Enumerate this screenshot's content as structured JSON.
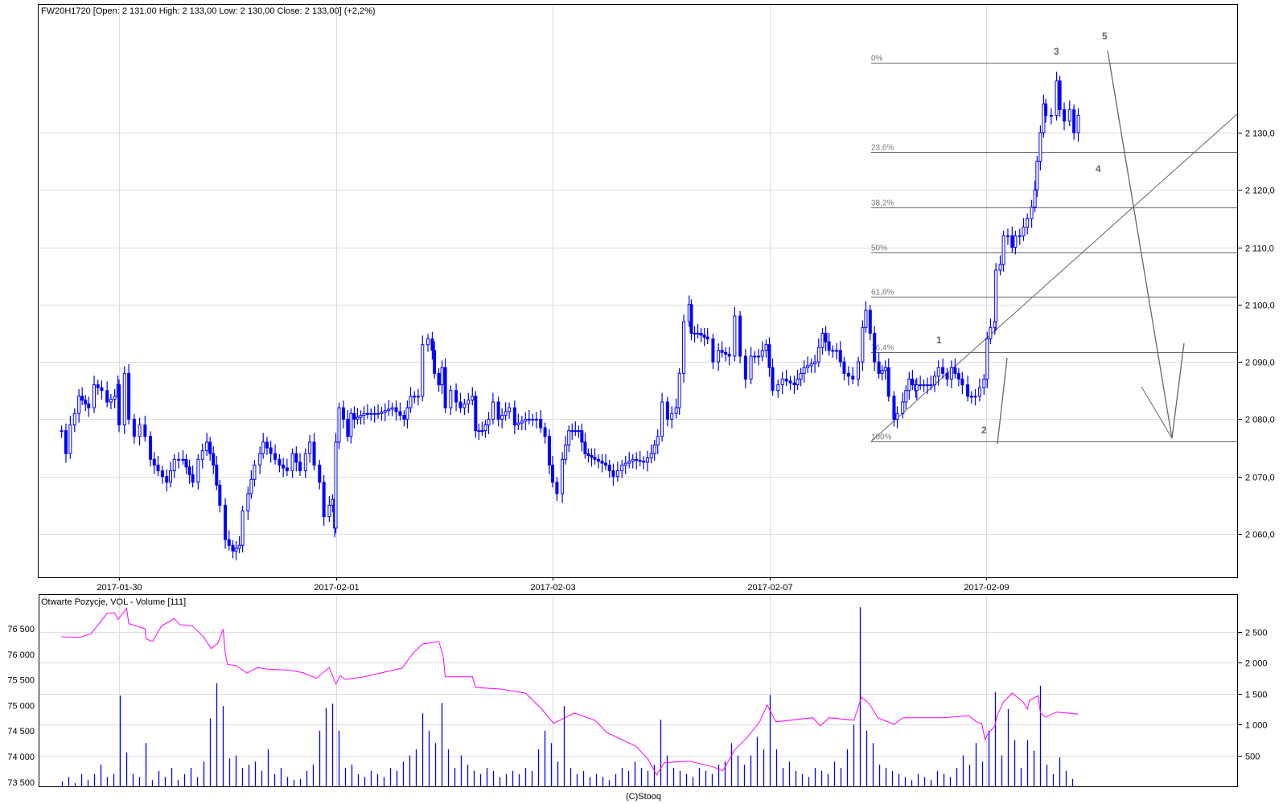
{
  "chart_data": [
    {
      "type": "candlestick",
      "title": "FW20H1720 [Open: 2 131,00  High: 2 133,00  Low: 2 130,00  Close: 2 133,00] (+2,2%)",
      "ylabel": "",
      "ylim": [
        2053,
        2150
      ],
      "x_unit": "trading sessions from 2017-01-30",
      "grid": true,
      "x_ticks": [
        {
          "t": 0,
          "label": "2017-01-30"
        },
        {
          "t": 2,
          "label": "2017-02-01"
        },
        {
          "t": 4,
          "label": "2017-02-03"
        },
        {
          "t": 6,
          "label": "2017-02-07"
        },
        {
          "t": 8,
          "label": "2017-02-09"
        }
      ],
      "y_ticks": [
        {
          "v": 2130,
          "label": "2 130,0"
        },
        {
          "v": 2120,
          "label": "2 120,0"
        },
        {
          "v": 2110,
          "label": "2 110,0"
        },
        {
          "v": 2100,
          "label": "2 100,0"
        },
        {
          "v": 2090,
          "label": "2 090,0"
        },
        {
          "v": 2080,
          "label": "2 080,0"
        },
        {
          "v": 2070,
          "label": "2 070,0"
        },
        {
          "v": 2060,
          "label": "2 060,0"
        }
      ],
      "series_color": "#0000ff",
      "close_points": [
        [
          -0.53,
          2078
        ],
        [
          -0.49,
          2074
        ],
        [
          -0.45,
          2079
        ],
        [
          -0.41,
          2081
        ],
        [
          -0.37,
          2084
        ],
        [
          -0.28,
          2082
        ],
        [
          -0.23,
          2086
        ],
        [
          -0.16,
          2085
        ],
        [
          -0.11,
          2083
        ],
        [
          -0.04,
          2084
        ],
        [
          -0.01,
          2086
        ],
        [
          0.0,
          2079
        ],
        [
          0.05,
          2088
        ],
        [
          0.09,
          2080
        ],
        [
          0.14,
          2077
        ],
        [
          0.19,
          2079
        ],
        [
          0.24,
          2077
        ],
        [
          0.29,
          2073
        ],
        [
          0.36,
          2071
        ],
        [
          0.44,
          2069
        ],
        [
          0.51,
          2073
        ],
        [
          0.59,
          2073
        ],
        [
          0.68,
          2069
        ],
        [
          0.73,
          2073
        ],
        [
          0.81,
          2076
        ],
        [
          0.87,
          2072
        ],
        [
          0.93,
          2065
        ],
        [
          0.98,
          2059
        ],
        [
          1.05,
          2057
        ],
        [
          1.11,
          2058
        ],
        [
          1.14,
          2064
        ],
        [
          1.19,
          2067
        ],
        [
          1.25,
          2072
        ],
        [
          1.3,
          2074
        ],
        [
          1.33,
          2076
        ],
        [
          1.4,
          2074
        ],
        [
          1.48,
          2072
        ],
        [
          1.55,
          2071
        ],
        [
          1.6,
          2074
        ],
        [
          1.67,
          2071
        ],
        [
          1.72,
          2074
        ],
        [
          1.76,
          2076
        ],
        [
          1.8,
          2072
        ],
        [
          1.85,
          2069
        ],
        [
          1.89,
          2063
        ],
        [
          1.94,
          2065
        ],
        [
          1.97,
          2066
        ],
        [
          1.99,
          2061
        ],
        [
          2.0,
          2076
        ],
        [
          2.03,
          2082
        ],
        [
          2.07,
          2080
        ],
        [
          2.11,
          2077
        ],
        [
          2.14,
          2081
        ],
        [
          2.17,
          2080
        ],
        [
          2.26,
          2081
        ],
        [
          2.39,
          2081
        ],
        [
          2.52,
          2082
        ],
        [
          2.63,
          2080
        ],
        [
          2.69,
          2084
        ],
        [
          2.76,
          2084
        ],
        [
          2.8,
          2093
        ],
        [
          2.85,
          2094
        ],
        [
          2.89,
          2092
        ],
        [
          2.91,
          2088
        ],
        [
          2.95,
          2086
        ],
        [
          2.98,
          2089
        ],
        [
          3.01,
          2082
        ],
        [
          3.06,
          2085
        ],
        [
          3.11,
          2083
        ],
        [
          3.15,
          2082
        ],
        [
          3.26,
          2084
        ],
        [
          3.29,
          2078
        ],
        [
          3.35,
          2078
        ],
        [
          3.41,
          2080
        ],
        [
          3.45,
          2083
        ],
        [
          3.5,
          2080
        ],
        [
          3.6,
          2082
        ],
        [
          3.65,
          2079
        ],
        [
          3.75,
          2080
        ],
        [
          3.85,
          2080
        ],
        [
          3.93,
          2077
        ],
        [
          3.97,
          2072
        ],
        [
          4.0,
          2069
        ],
        [
          4.04,
          2067
        ],
        [
          4.09,
          2073
        ],
        [
          4.15,
          2078
        ],
        [
          4.24,
          2078
        ],
        [
          4.3,
          2074
        ],
        [
          4.39,
          2073
        ],
        [
          4.49,
          2072
        ],
        [
          4.56,
          2070
        ],
        [
          4.64,
          2072
        ],
        [
          4.74,
          2073
        ],
        [
          4.84,
          2072.5
        ],
        [
          4.91,
          2074
        ],
        [
          4.97,
          2077
        ],
        [
          5.01,
          2083
        ],
        [
          5.06,
          2080
        ],
        [
          5.14,
          2082
        ],
        [
          5.17,
          2088
        ],
        [
          5.21,
          2097
        ],
        [
          5.26,
          2100
        ],
        [
          5.28,
          2095
        ],
        [
          5.34,
          2095
        ],
        [
          5.43,
          2094
        ],
        [
          5.48,
          2090
        ],
        [
          5.53,
          2092
        ],
        [
          5.63,
          2091
        ],
        [
          5.68,
          2098
        ],
        [
          5.73,
          2091
        ],
        [
          5.78,
          2087
        ],
        [
          5.83,
          2091
        ],
        [
          5.9,
          2091
        ],
        [
          5.97,
          2093
        ],
        [
          6.03,
          2085
        ],
        [
          6.08,
          2086
        ],
        [
          6.12,
          2087
        ],
        [
          6.23,
          2086
        ],
        [
          6.32,
          2089
        ],
        [
          6.42,
          2090
        ],
        [
          6.49,
          2095
        ],
        [
          6.55,
          2092
        ],
        [
          6.62,
          2092
        ],
        [
          6.69,
          2088
        ],
        [
          6.77,
          2087
        ],
        [
          6.82,
          2090
        ],
        [
          6.86,
          2096
        ],
        [
          6.89,
          2099
        ],
        [
          6.93,
          2095
        ],
        [
          6.97,
          2090
        ],
        [
          7.01,
          2088
        ],
        [
          7.07,
          2089
        ],
        [
          7.1,
          2084
        ],
        [
          7.15,
          2080
        ],
        [
          7.18,
          2081
        ],
        [
          7.23,
          2083
        ],
        [
          7.29,
          2087
        ],
        [
          7.35,
          2085
        ],
        [
          7.36,
          2086
        ],
        [
          7.49,
          2086
        ],
        [
          7.56,
          2089
        ],
        [
          7.64,
          2087
        ],
        [
          7.68,
          2089
        ],
        [
          7.78,
          2086
        ],
        [
          7.83,
          2084
        ],
        [
          7.9,
          2084
        ],
        [
          7.98,
          2087
        ],
        [
          8.01,
          2094
        ],
        [
          8.04,
          2096
        ],
        [
          8.08,
          2097
        ],
        [
          8.09,
          2106
        ],
        [
          8.13,
          2107
        ],
        [
          8.16,
          2112
        ],
        [
          8.2,
          2112
        ],
        [
          8.24,
          2110
        ],
        [
          8.27,
          2112
        ],
        [
          8.31,
          2112
        ],
        [
          8.38,
          2115
        ],
        [
          8.42,
          2117
        ],
        [
          8.45,
          2120
        ],
        [
          8.47,
          2125
        ],
        [
          8.5,
          2130
        ],
        [
          8.53,
          2135
        ],
        [
          8.55,
          2133
        ],
        [
          8.6,
          2133
        ],
        [
          8.65,
          2139
        ],
        [
          8.68,
          2134
        ],
        [
          8.72,
          2132
        ],
        [
          8.77,
          2134
        ],
        [
          8.81,
          2130
        ],
        [
          8.85,
          2133
        ]
      ],
      "fibonacci": {
        "high": 2142.2,
        "low": 2076.1,
        "levels": [
          {
            "ratio": 0,
            "label": "0%"
          },
          {
            "ratio": 0.236,
            "label": "23,6%"
          },
          {
            "ratio": 0.382,
            "label": "38,2%"
          },
          {
            "ratio": 0.5,
            "label": "50%"
          },
          {
            "ratio": 0.618,
            "label": "61,8%"
          },
          {
            "ratio": 0.764,
            "label": "76,4%"
          },
          {
            "ratio": 1,
            "label": "100%"
          }
        ]
      },
      "wave_labels": [
        "1",
        "2",
        "3",
        "4",
        "5"
      ]
    },
    {
      "type": "bar+line",
      "title": "Otwarte Pozycje, VOL - Volume [111]",
      "left_axis": {
        "name": "Otwarte Pozycje",
        "ylim": [
          73500,
          77000
        ],
        "ticks": [
          "76 500",
          "76 000",
          "75 500",
          "75 000",
          "74 500",
          "74 000",
          "73 500"
        ],
        "tick_values": [
          76500,
          76000,
          75500,
          75000,
          74500,
          74000,
          73500
        ]
      },
      "right_axis": {
        "name": "Volume",
        "ylim": [
          0,
          3000
        ],
        "ticks": [
          "2 500",
          "2 000",
          "1 500",
          "1 000",
          "500"
        ],
        "tick_values": [
          2500,
          2000,
          1500,
          1000,
          500
        ]
      },
      "open_interest_color": "#ff00ff",
      "volume_color": "#0000ff",
      "open_interest": [
        [
          -0.53,
          76343
        ],
        [
          -0.36,
          76330
        ],
        [
          -0.26,
          76400
        ],
        [
          -0.11,
          76800
        ],
        [
          -0.04,
          76810
        ],
        [
          -0.01,
          76680
        ],
        [
          0.07,
          76900
        ],
        [
          0.09,
          76600
        ],
        [
          0.24,
          76500
        ],
        [
          0.25,
          76300
        ],
        [
          0.31,
          76250
        ],
        [
          0.39,
          76550
        ],
        [
          0.51,
          76700
        ],
        [
          0.56,
          76580
        ],
        [
          0.68,
          76550
        ],
        [
          0.78,
          76340
        ],
        [
          0.85,
          76110
        ],
        [
          0.91,
          76210
        ],
        [
          0.96,
          76490
        ],
        [
          0.98,
          76010
        ],
        [
          1.0,
          75800
        ],
        [
          1.08,
          75780
        ],
        [
          1.18,
          75630
        ],
        [
          1.22,
          75680
        ],
        [
          1.28,
          75740
        ],
        [
          1.37,
          75710
        ],
        [
          1.57,
          75690
        ],
        [
          1.7,
          75640
        ],
        [
          1.82,
          75530
        ],
        [
          1.94,
          75740
        ],
        [
          2.0,
          75420
        ],
        [
          2.04,
          75580
        ],
        [
          2.09,
          75510
        ],
        [
          2.24,
          75550
        ],
        [
          2.49,
          75670
        ],
        [
          2.61,
          75730
        ],
        [
          2.72,
          76040
        ],
        [
          2.8,
          76200
        ],
        [
          2.95,
          76250
        ],
        [
          2.99,
          75970
        ],
        [
          3.01,
          75560
        ],
        [
          3.26,
          75560
        ],
        [
          3.29,
          75350
        ],
        [
          3.52,
          75320
        ],
        [
          3.75,
          75240
        ],
        [
          3.9,
          74930
        ],
        [
          4.01,
          74650
        ],
        [
          4.2,
          74850
        ],
        [
          4.39,
          74710
        ],
        [
          4.5,
          74470
        ],
        [
          4.77,
          74200
        ],
        [
          4.88,
          73950
        ],
        [
          4.96,
          73640
        ],
        [
          5.03,
          73880
        ],
        [
          5.26,
          73910
        ],
        [
          5.48,
          73800
        ],
        [
          5.57,
          73720
        ],
        [
          5.68,
          74130
        ],
        [
          5.79,
          74360
        ],
        [
          5.91,
          74680
        ],
        [
          5.98,
          75010
        ],
        [
          6.06,
          74680
        ],
        [
          6.4,
          74760
        ],
        [
          6.47,
          74600
        ],
        [
          6.55,
          74760
        ],
        [
          6.78,
          74710
        ],
        [
          6.85,
          75160
        ],
        [
          6.92,
          75040
        ],
        [
          7.0,
          74760
        ],
        [
          7.15,
          74630
        ],
        [
          7.23,
          74760
        ],
        [
          7.61,
          74760
        ],
        [
          7.84,
          74800
        ],
        [
          7.91,
          74680
        ],
        [
          7.96,
          74640
        ],
        [
          7.99,
          74330
        ],
        [
          8.01,
          74420
        ],
        [
          8.08,
          74600
        ],
        [
          8.1,
          74800
        ],
        [
          8.16,
          75070
        ],
        [
          8.24,
          75240
        ],
        [
          8.3,
          75140
        ],
        [
          8.34,
          75070
        ],
        [
          8.38,
          74930
        ],
        [
          8.4,
          75100
        ],
        [
          8.48,
          75190
        ],
        [
          8.5,
          74850
        ],
        [
          8.55,
          74770
        ],
        [
          8.6,
          74820
        ],
        [
          8.65,
          74870
        ],
        [
          8.75,
          74850
        ],
        [
          8.85,
          74830
        ]
      ],
      "volume_t_start": -0.53,
      "volume_t_step": 0.0594,
      "volume": [
        80,
        150,
        50,
        200,
        100,
        200,
        350,
        150,
        200,
        1470,
        550,
        200,
        150,
        700,
        100,
        250,
        150,
        300,
        100,
        200,
        300,
        150,
        400,
        1100,
        1670,
        1300,
        450,
        500,
        300,
        350,
        400,
        250,
        600,
        200,
        300,
        150,
        100,
        120,
        250,
        350,
        900,
        1270,
        1340,
        900,
        300,
        350,
        200,
        150,
        250,
        200,
        150,
        300,
        250,
        400,
        500,
        600,
        1180,
        900,
        700,
        1350,
        600,
        300,
        500,
        350,
        250,
        200,
        300,
        250,
        150,
        200,
        250,
        200,
        300,
        250,
        600,
        900,
        700,
        400,
        1300,
        300,
        200,
        250,
        150,
        200,
        150,
        100,
        200,
        300,
        250,
        400,
        300,
        250,
        350,
        1080,
        500,
        300,
        250,
        200,
        150,
        300,
        250,
        200,
        350,
        400,
        700,
        500,
        350,
        500,
        800,
        600,
        1480,
        600,
        300,
        400,
        250,
        200,
        150,
        300,
        250,
        200,
        400,
        300,
        600,
        1000,
        2900,
        900,
        700,
        350,
        300,
        250,
        200,
        150,
        100,
        200,
        150,
        100,
        250,
        200,
        150,
        300,
        500,
        350,
        700,
        400,
        900,
        1530,
        500,
        1250,
        750,
        300,
        750,
        580,
        1630,
        350,
        200,
        470,
        250,
        120
      ]
    }
  ],
  "footer": "(C)Stooq"
}
